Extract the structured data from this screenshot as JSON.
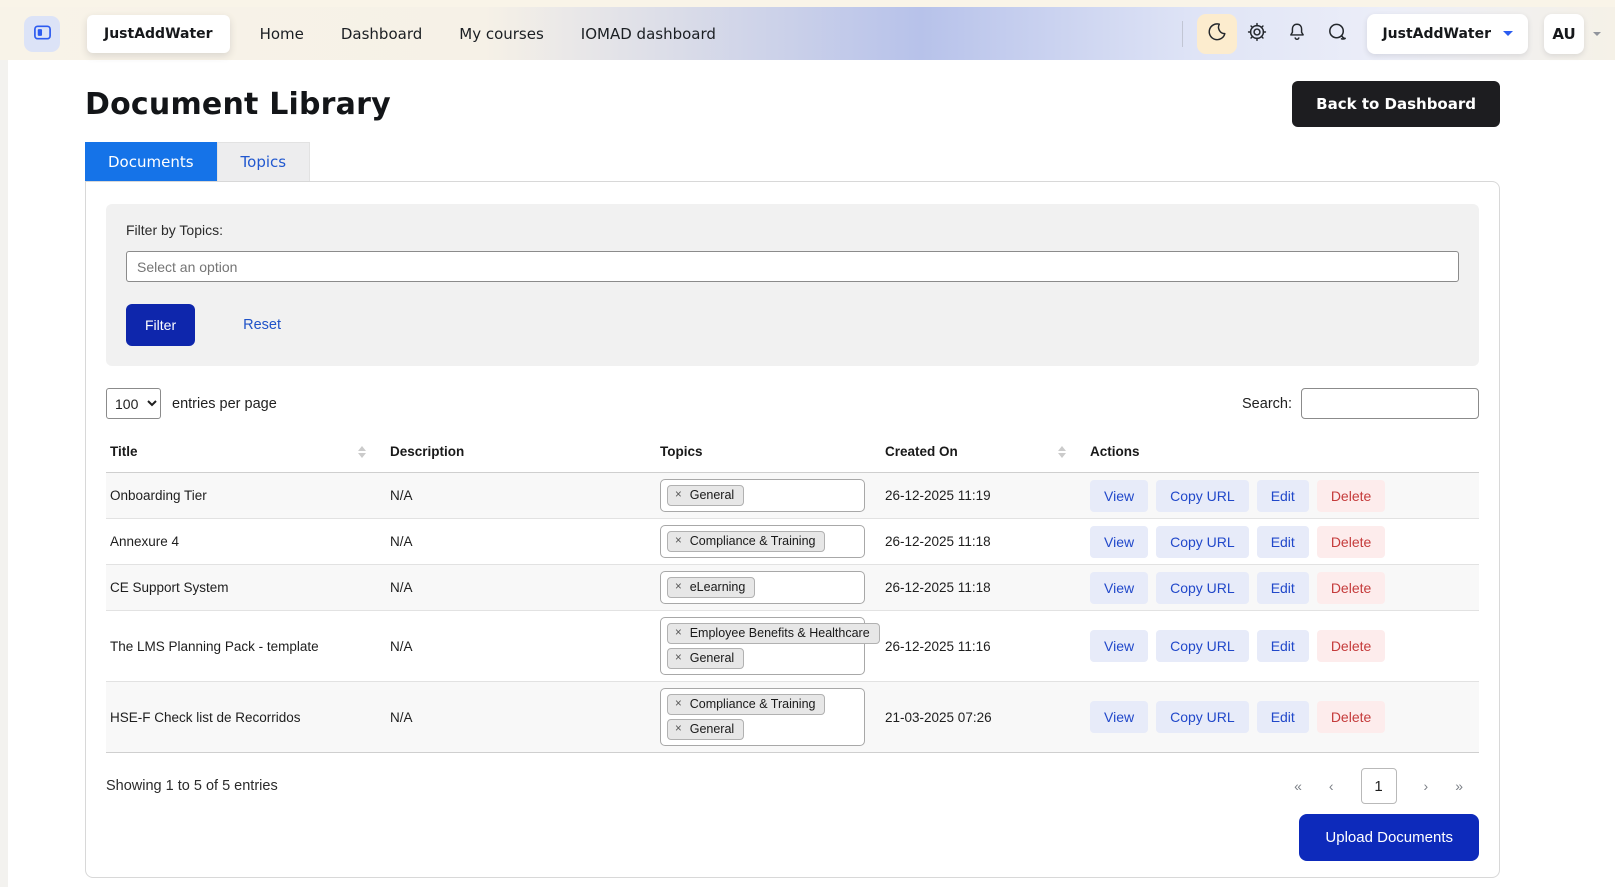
{
  "navbar": {
    "brand": "JustAddWater",
    "links": [
      "Home",
      "Dashboard",
      "My courses",
      "IOMAD dashboard"
    ],
    "icons": [
      "sidebar-toggle-icon",
      "moon-icon",
      "gear-icon",
      "bell-icon",
      "chat-icon"
    ],
    "user_menu_label": "JustAddWater",
    "avatar_initials": "AU"
  },
  "page": {
    "title": "Document Library",
    "back_button": "Back to Dashboard",
    "tabs": [
      {
        "label": "Documents",
        "active": true
      },
      {
        "label": "Topics",
        "active": false
      }
    ]
  },
  "filter": {
    "label": "Filter by Topics:",
    "placeholder": "Select an option",
    "filter_button": "Filter",
    "reset_link": "Reset"
  },
  "controls": {
    "page_size": "100",
    "entries_label": "entries per page",
    "search_label": "Search:",
    "search_value": ""
  },
  "table": {
    "headers": [
      "Title",
      "Description",
      "Topics",
      "Created On",
      "Actions"
    ],
    "tag_remove_glyph": "×",
    "actions": [
      {
        "label": "View",
        "variant": "blue"
      },
      {
        "label": "Copy URL",
        "variant": "blue"
      },
      {
        "label": "Edit",
        "variant": "blue"
      },
      {
        "label": "Delete",
        "variant": "red"
      }
    ],
    "rows": [
      {
        "title": "Onboarding Tier",
        "description": "N/A",
        "topics": [
          "General"
        ],
        "created_on": "26-12-2025 11:19"
      },
      {
        "title": "Annexure 4",
        "description": "N/A",
        "topics": [
          "Compliance & Training"
        ],
        "created_on": "26-12-2025 11:18"
      },
      {
        "title": "CE Support System",
        "description": "N/A",
        "topics": [
          "eLearning"
        ],
        "created_on": "26-12-2025 11:18"
      },
      {
        "title": "The LMS Planning Pack - template",
        "description": "N/A",
        "topics": [
          "Employee Benefits & Healthcare",
          "General"
        ],
        "created_on": "26-12-2025 11:16"
      },
      {
        "title": "HSE-F Check list de Recorridos",
        "description": "N/A",
        "topics": [
          "Compliance & Training",
          "General"
        ],
        "created_on": "21-03-2025 07:26"
      }
    ]
  },
  "footer": {
    "summary": "Showing 1 to 5 of 5 entries",
    "pagination": {
      "first": "«",
      "prev": "‹",
      "page": "1",
      "next": "›",
      "last": "»"
    },
    "upload_button": "Upload Documents"
  },
  "colors": {
    "primary_navy": "#0e26ac",
    "tab_active_blue": "#1573e8",
    "link_blue": "#2053c8",
    "action_blue_bg": "#e7ebf9",
    "delete_red": "#c53b3b",
    "delete_bg": "#fdecec",
    "topbar_cream": "#f8f3e8",
    "topbar_periwinkle": "#b7c2ea",
    "moon_button_bg": "#fcecce",
    "back_button_dark": "#1d1d20"
  }
}
